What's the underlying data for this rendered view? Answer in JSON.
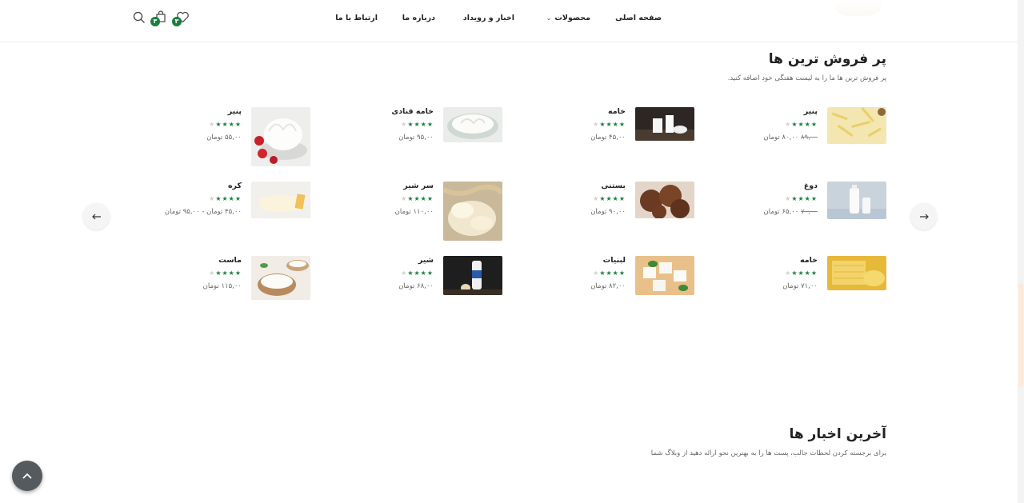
{
  "nav": {
    "items": [
      {
        "label": "صفحه اصلی"
      },
      {
        "label": "محصولات"
      },
      {
        "label": "اخبار و رویداد"
      },
      {
        "label": "درباره ما"
      },
      {
        "label": "ارتباط با ما"
      }
    ],
    "wishlist_count": "۳",
    "cart_count": "۳"
  },
  "bestsellers": {
    "title": "پر فروش ترین ها",
    "subtitle": "پر فروش ترین ها ما را به لیست هفتگی خود اضافه کنید.",
    "products": [
      {
        "name": "پنیر",
        "old_price": "۸۹,۰۰",
        "price": "۸۰,۰۰ تومان",
        "rating": 4
      },
      {
        "name": "خامه",
        "price": "۴۵,۰۰ تومان",
        "rating": 4
      },
      {
        "name": "خامه قنادی",
        "price": "۹۵,۰۰ تومان",
        "rating": 4
      },
      {
        "name": "پنیر",
        "price": "۵۵,۰۰ تومان",
        "rating": 4
      },
      {
        "name": "دوغ",
        "old_price": "۷۰,۰۰",
        "price": "۶۵,۰۰ تومان",
        "rating": 4
      },
      {
        "name": "بستنی",
        "price": "۹۰,۰۰ تومان",
        "rating": 4
      },
      {
        "name": "سر شیر",
        "price": "۱۱۰,۰۰ تومان",
        "rating": 4
      },
      {
        "name": "کره",
        "price": "۴۵,۰۰ تومان - ۹۵,۰۰ تومان",
        "rating": 4
      },
      {
        "name": "خامه",
        "price": "۷۱,۰۰ تومان",
        "rating": 4
      },
      {
        "name": "لبنیات",
        "price": "۸۲,۰۰ تومان",
        "rating": 4
      },
      {
        "name": "شیر",
        "price": "۶۸,۰۰ تومان",
        "rating": 4
      },
      {
        "name": "ماست",
        "price": "۱۱۵,۰۰ تومان",
        "rating": 4
      }
    ]
  },
  "news": {
    "title": "آخرین اخبار ها",
    "subtitle": "برای برجسته کردن لحظات جالب، پست ها را به بهترین نحو ارائه دهید از وبلاگ شما"
  },
  "colors": {
    "accent": "#1a7f3c"
  }
}
